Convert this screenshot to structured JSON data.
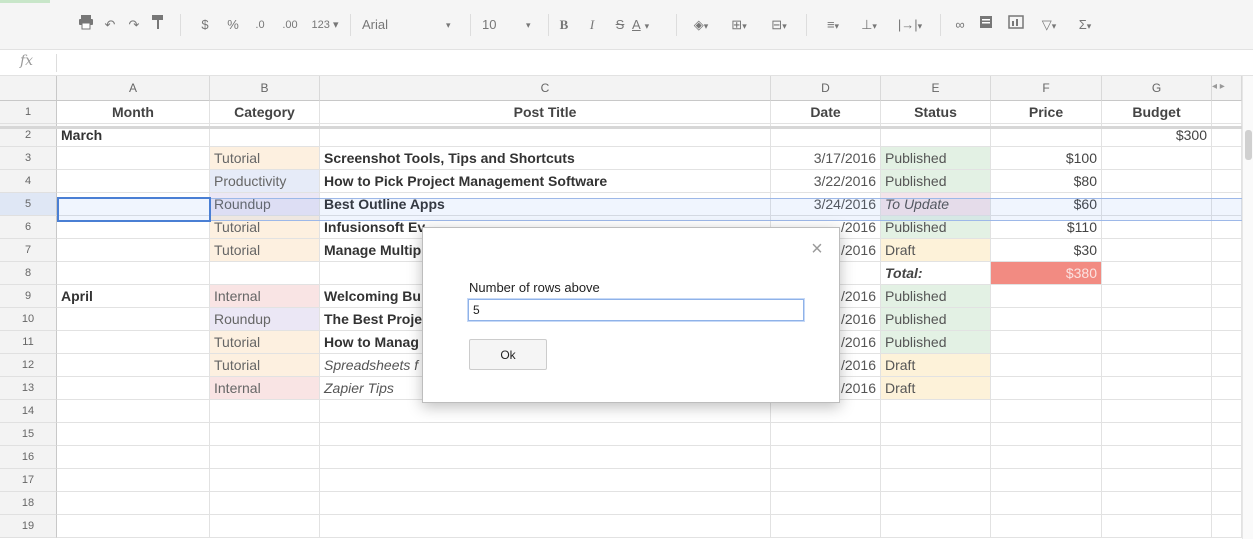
{
  "toolbar": {
    "print_icon": "printer-icon",
    "undo_icon": "undo-icon",
    "redo_icon": "redo-icon",
    "paint_format_icon": "paint-format-icon",
    "currency": "$",
    "percent": "%",
    "dec_decrease": ".0",
    "dec_increase": ".00",
    "more_formats": "123 ▾",
    "font": "Arial",
    "font_size": "10",
    "bold": "B",
    "italic": "I",
    "strike": "S",
    "text_color": "A"
  },
  "formula_bar": {
    "fx": "fx",
    "value": ""
  },
  "columns": [
    "A",
    "B",
    "C",
    "D",
    "E",
    "F",
    "G"
  ],
  "rows": [
    "1",
    "2",
    "3",
    "4",
    "5",
    "6",
    "7",
    "8",
    "9",
    "10",
    "11",
    "12",
    "13",
    "14",
    "15",
    "16",
    "17",
    "18",
    "19"
  ],
  "header_row": {
    "month": "Month",
    "category": "Category",
    "post_title": "Post Title",
    "date": "Date",
    "status": "Status",
    "price": "Price",
    "budget": "Budget"
  },
  "data_rows": [
    {
      "month": "March",
      "category": "",
      "title": "",
      "date": "",
      "status": "",
      "price": "",
      "budget": "$300"
    },
    {
      "month": "",
      "category": "Tutorial",
      "title": "Screenshot Tools, Tips and Shortcuts",
      "date": "3/17/2016",
      "status": "Published",
      "price": "$100",
      "budget": ""
    },
    {
      "month": "",
      "category": "Productivity",
      "title": "How to Pick Project Management Software",
      "date": "3/22/2016",
      "status": "Published",
      "price": "$80",
      "budget": ""
    },
    {
      "month": "",
      "category": "Roundup",
      "title": "Best Outline Apps",
      "date": "3/24/2016",
      "status": "To Update",
      "price": "$60",
      "budget": ""
    },
    {
      "month": "",
      "category": "Tutorial",
      "title": "Infusionsoft Ev",
      "date": "/2016",
      "status": "Published",
      "price": "$110",
      "budget": ""
    },
    {
      "month": "",
      "category": "Tutorial",
      "title": "Manage Multip",
      "date": "/2016",
      "status": "Draft",
      "price": "$30",
      "budget": ""
    },
    {
      "month": "",
      "category": "",
      "title": "",
      "date": "",
      "status": "Total:",
      "price": "$380",
      "budget": ""
    },
    {
      "month": "April",
      "category": "Internal",
      "title": "Welcoming Bu",
      "date": "/2016",
      "status": "Published",
      "price": "",
      "budget": ""
    },
    {
      "month": "",
      "category": "Roundup",
      "title": "The Best Proje",
      "date": "/2016",
      "status": "Published",
      "price": "",
      "budget": ""
    },
    {
      "month": "",
      "category": "Tutorial",
      "title": "How to Manag",
      "date": "/2016",
      "status": "Published",
      "price": "",
      "budget": ""
    },
    {
      "month": "",
      "category": "Tutorial",
      "title": "Spreadsheets f",
      "date": "/2016",
      "status": "Draft",
      "price": "",
      "budget": ""
    },
    {
      "month": "",
      "category": "Internal",
      "title": "Zapier Tips",
      "date": "/2016",
      "status": "Draft",
      "price": "",
      "budget": ""
    }
  ],
  "dialog": {
    "label": "Number of rows above",
    "input_value": "5",
    "ok_label": "Ok",
    "close_icon": "close-icon"
  },
  "colors": {
    "tutorial": "#fdf0e0",
    "productivity": "#e6ebf8",
    "roundup": "#ebe7f5",
    "internal": "#f9e4e4",
    "published": "#e3f1e4",
    "to_update": "#f3e4ea",
    "draft": "#fdf2d9",
    "total_price": "#f28b82",
    "selection": "#4a7fd4"
  }
}
